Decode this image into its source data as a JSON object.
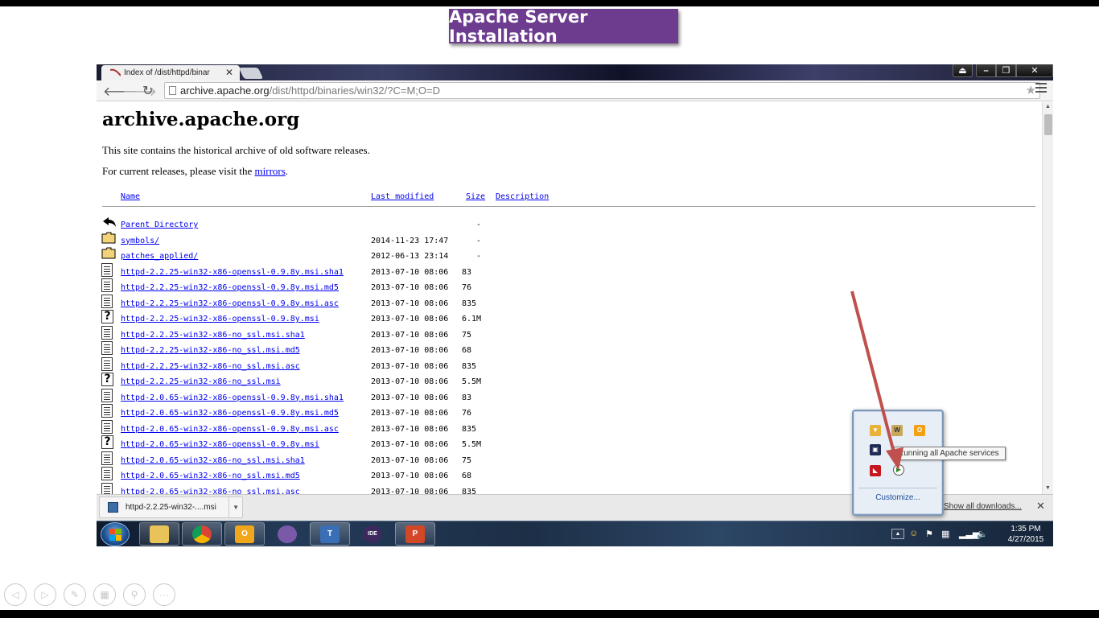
{
  "slide": {
    "title": "Apache Server Installation",
    "controls": [
      "previous-slide",
      "next-slide",
      "pen",
      "slides",
      "zoom",
      "more"
    ]
  },
  "browser": {
    "tab": {
      "title": "Index of /dist/httpd/binar"
    },
    "window_controls": [
      "user-profile",
      "minimize",
      "restore",
      "close"
    ],
    "url": {
      "host": "archive.apache.org",
      "path": "/dist/httpd/binaries/win32/?C=M;O=D"
    }
  },
  "page": {
    "heading": "archive.apache.org",
    "intro": "This site contains the historical archive of old software releases.",
    "current_prefix": "For current releases, please visit the ",
    "mirrors_link": "mirrors",
    "current_suffix": ".",
    "columns": {
      "name": "Name",
      "last_modified": "Last modified",
      "size": "Size",
      "description": "Description"
    },
    "rows": [
      {
        "icon": "back",
        "name": "Parent Directory",
        "date": "",
        "size": "-"
      },
      {
        "icon": "folder",
        "name": "symbols/",
        "date": "2014-11-23 17:47",
        "size": "-"
      },
      {
        "icon": "folder",
        "name": "patches_applied/",
        "date": "2012-06-13 23:14",
        "size": "-"
      },
      {
        "icon": "text",
        "name": "httpd-2.2.25-win32-x86-openssl-0.9.8y.msi.sha1",
        "date": "2013-07-10 08:06",
        "size": "83"
      },
      {
        "icon": "text",
        "name": "httpd-2.2.25-win32-x86-openssl-0.9.8y.msi.md5",
        "date": "2013-07-10 08:06",
        "size": "76"
      },
      {
        "icon": "text",
        "name": "httpd-2.2.25-win32-x86-openssl-0.9.8y.msi.asc",
        "date": "2013-07-10 08:06",
        "size": "835"
      },
      {
        "icon": "unknown",
        "name": "httpd-2.2.25-win32-x86-openssl-0.9.8y.msi",
        "date": "2013-07-10 08:06",
        "size": "6.1M"
      },
      {
        "icon": "text",
        "name": "httpd-2.2.25-win32-x86-no_ssl.msi.sha1",
        "date": "2013-07-10 08:06",
        "size": "75"
      },
      {
        "icon": "text",
        "name": "httpd-2.2.25-win32-x86-no_ssl.msi.md5",
        "date": "2013-07-10 08:06",
        "size": "68"
      },
      {
        "icon": "text",
        "name": "httpd-2.2.25-win32-x86-no_ssl.msi.asc",
        "date": "2013-07-10 08:06",
        "size": "835"
      },
      {
        "icon": "unknown",
        "name": "httpd-2.2.25-win32-x86-no_ssl.msi",
        "date": "2013-07-10 08:06",
        "size": "5.5M"
      },
      {
        "icon": "text",
        "name": "httpd-2.0.65-win32-x86-openssl-0.9.8y.msi.sha1",
        "date": "2013-07-10 08:06",
        "size": "83"
      },
      {
        "icon": "text",
        "name": "httpd-2.0.65-win32-x86-openssl-0.9.8y.msi.md5",
        "date": "2013-07-10 08:06",
        "size": "76"
      },
      {
        "icon": "text",
        "name": "httpd-2.0.65-win32-x86-openssl-0.9.8y.msi.asc",
        "date": "2013-07-10 08:06",
        "size": "835"
      },
      {
        "icon": "unknown",
        "name": "httpd-2.0.65-win32-x86-openssl-0.9.8y.msi",
        "date": "2013-07-10 08:06",
        "size": "5.5M"
      },
      {
        "icon": "text",
        "name": "httpd-2.0.65-win32-x86-no_ssl.msi.sha1",
        "date": "2013-07-10 08:06",
        "size": "75"
      },
      {
        "icon": "text",
        "name": "httpd-2.0.65-win32-x86-no_ssl.msi.md5",
        "date": "2013-07-10 08:06",
        "size": "68"
      },
      {
        "icon": "text",
        "name": "httpd-2.0.65-win32-x86-no_ssl.msi.asc",
        "date": "2013-07-10 08:06",
        "size": "835"
      }
    ]
  },
  "downloads": {
    "item": "httpd-2.2.25-win32-....msi",
    "show_all": "Show all downloads..."
  },
  "taskbar": {
    "apps": [
      "explorer",
      "chrome",
      "outlook",
      "pidgin",
      "tortoise",
      "eclipse",
      "powerpoint"
    ],
    "clock": {
      "time": "1:35 PM",
      "date": "4/27/2015"
    }
  },
  "tray_popup": {
    "tooltip": "Running all Apache services",
    "customize": "Customize..."
  },
  "colors": {
    "slide_title_bg": "#6d3c8f",
    "link": "#0000ee",
    "annotation_arrow": "#c0504d"
  }
}
